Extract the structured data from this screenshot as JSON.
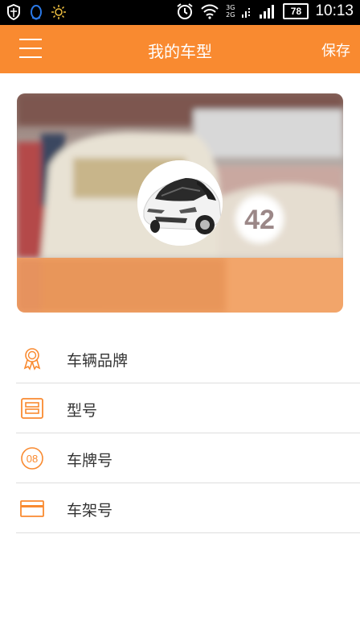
{
  "status_bar": {
    "network_top": "3G",
    "network_bottom": "2G",
    "battery": "78",
    "time": "10:13"
  },
  "header": {
    "title": "我的车型",
    "save_label": "保存"
  },
  "banner": {
    "race_number": "42"
  },
  "list": {
    "items": [
      {
        "label": "车辆品牌",
        "icon": "award-ribbon-icon"
      },
      {
        "label": "型号",
        "icon": "model-card-icon"
      },
      {
        "label": "车牌号",
        "icon": "plate-number-icon",
        "icon_text": "08"
      },
      {
        "label": "车架号",
        "icon": "credit-card-icon"
      }
    ]
  },
  "colors": {
    "accent": "#f98a30",
    "banner_overlay": "#f2a56a",
    "divider": "#dedede",
    "text": "#333333"
  }
}
